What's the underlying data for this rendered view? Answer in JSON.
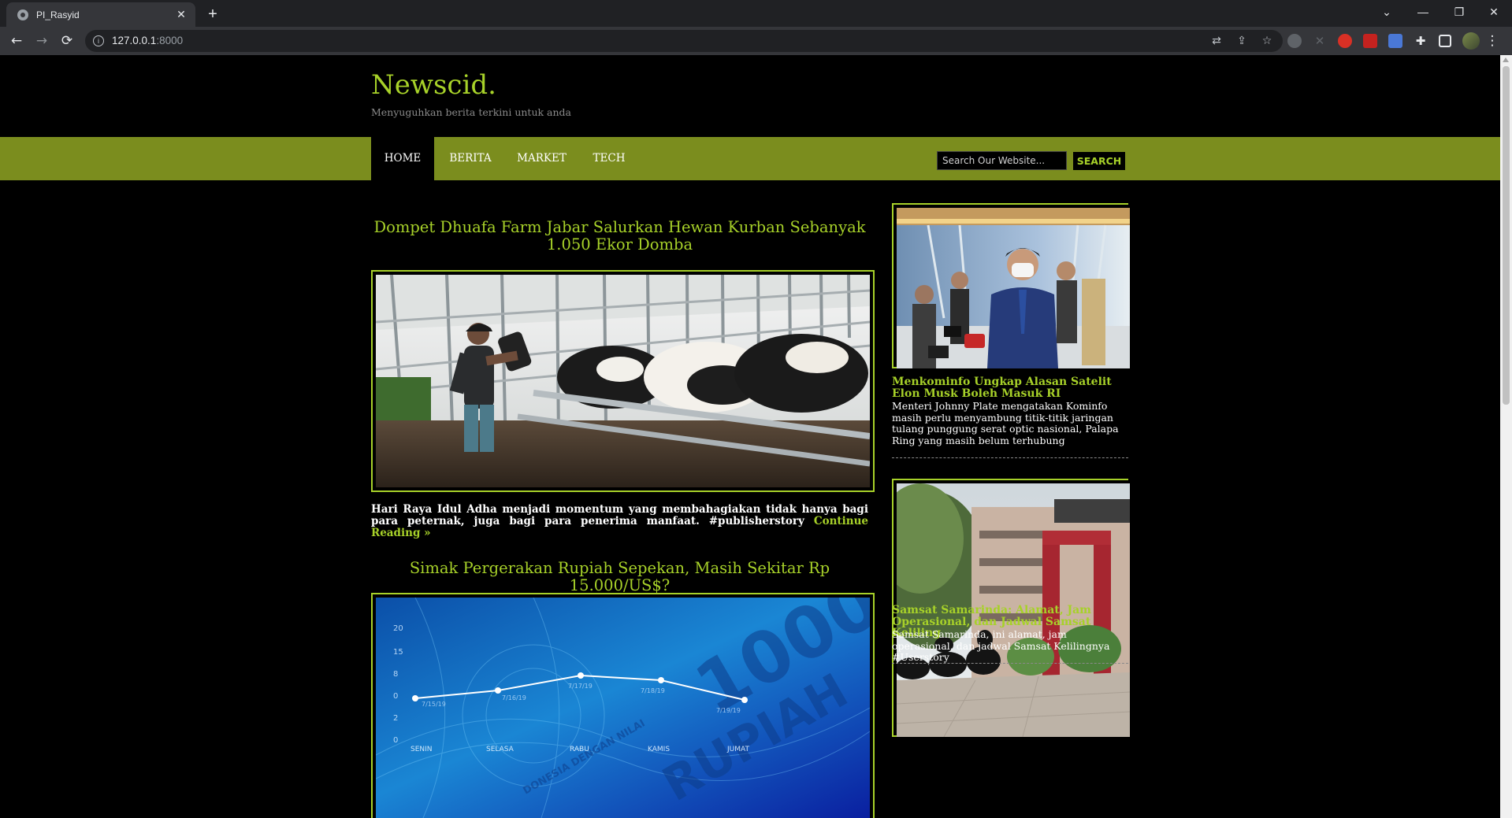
{
  "browser": {
    "tab_title": "PI_Rasyid",
    "tab_close": "✕",
    "new_tab": "+",
    "url_host": "127.0.0.1",
    "url_port": ":8000",
    "back": "←",
    "forward": "→",
    "reload": "⟳",
    "win_list": "⌄",
    "win_minimize": "—",
    "win_restore": "❐",
    "win_close": "✕",
    "menu": "⋮"
  },
  "site": {
    "title": "Newscid.",
    "tagline": "Menyuguhkan berita terkini untuk anda"
  },
  "nav": {
    "items": [
      {
        "label": "HOME"
      },
      {
        "label": "BERITA"
      },
      {
        "label": "MARKET"
      },
      {
        "label": "TECH"
      }
    ],
    "search_placeholder": "Search Our Website...",
    "search_button": "SEARCH"
  },
  "posts": [
    {
      "title": "Dompet Dhuafa Farm Jabar Salurkan Hewan Kurban Sebanyak 1.050 Ekor Domba",
      "excerpt": "Hari Raya Idul Adha menjadi momentum yang membahagiakan tidak hanya bagi para peternak, juga bagi para penerima manfaat. #publisherstory",
      "read_more": "Continue Reading »"
    },
    {
      "title": "Simak Pergerakan Rupiah Sepekan, Masih Sekitar Rp 15.000/US$?",
      "image_text": {
        "y_ticks": [
          "20",
          "15",
          "8",
          "0",
          "2",
          "0"
        ],
        "days": [
          "SENIN",
          "SELASA",
          "RABU",
          "KAMIS",
          "JUMAT"
        ],
        "dates": [
          "7/15/19",
          "7/16/19",
          "7/17/19",
          "7/18/19",
          "7/19/19"
        ],
        "banner": "RUPIAH",
        "denomination": "1000",
        "subtext": "DONESIA DENGAN NILAI"
      }
    }
  ],
  "sidebar": [
    {
      "title": "Menkominfo Ungkap Alasan Satelit Elon Musk Boleh Masuk RI",
      "desc": "Menteri Johnny Plate mengatakan Kominfo masih perlu menyambung titik-titik jaringan tulang punggung serat optic nasional, Palapa Ring yang masih belum terhubung"
    },
    {
      "title": "Samsat Samarinda: Alamat, Jam Operasional, dan Jadwal Samsat Keliling",
      "desc": "Samsat Samarinda, ini alamat, jam operasional, dan jadwal Samsat Kelilingnya #Userstory"
    }
  ],
  "colors": {
    "accent": "#a7d129",
    "nav_bg": "#7b8d1e",
    "page_bg": "#000000",
    "muted_text": "#8a8a8a"
  }
}
